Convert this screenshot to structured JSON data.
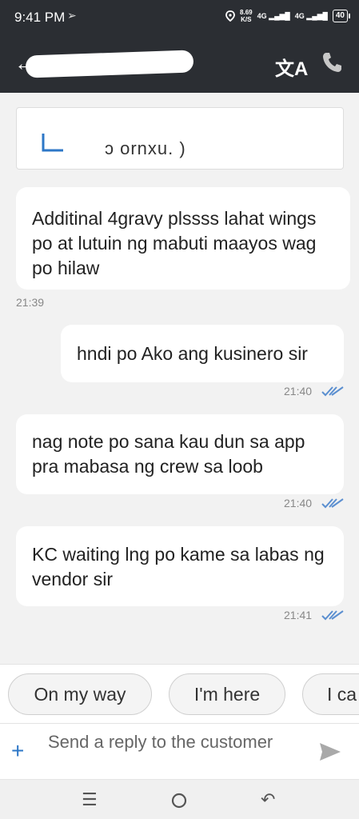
{
  "status_bar": {
    "time": "9:41 PM",
    "speed_value": "8.69",
    "speed_unit": "K/S",
    "network_1": "4G",
    "network_2": "4G",
    "battery": "40"
  },
  "header": {
    "translate_icon": "translate-icon",
    "call_icon": "phone-icon",
    "back_icon": "back-arrow-icon"
  },
  "pinned_card": {
    "snippet": "ɔ ornxu.         )"
  },
  "messages": [
    {
      "direction": "incoming",
      "text": "Additinal 4gravy plssss lahat wings po at lutuin ng mabuti maayos wag po hilaw",
      "time": "21:39"
    },
    {
      "direction": "outgoing",
      "text": "hndi po Ako ang kusinero sir",
      "time": "21:40"
    },
    {
      "direction": "outgoing",
      "text": "nag note po sana kau dun sa app pra mabasa ng crew sa loob",
      "time": "21:40"
    },
    {
      "direction": "outgoing",
      "text": "KC waiting lng po kame sa labas ng vendor sir",
      "time": "21:41"
    }
  ],
  "quick_replies": [
    "On my way",
    "I'm here",
    "I ca"
  ],
  "composer": {
    "placeholder": "Send a reply to the customer"
  },
  "colors": {
    "header_bg": "#2b2e33",
    "accent": "#2d77c7",
    "tick": "#5b8fd0"
  }
}
